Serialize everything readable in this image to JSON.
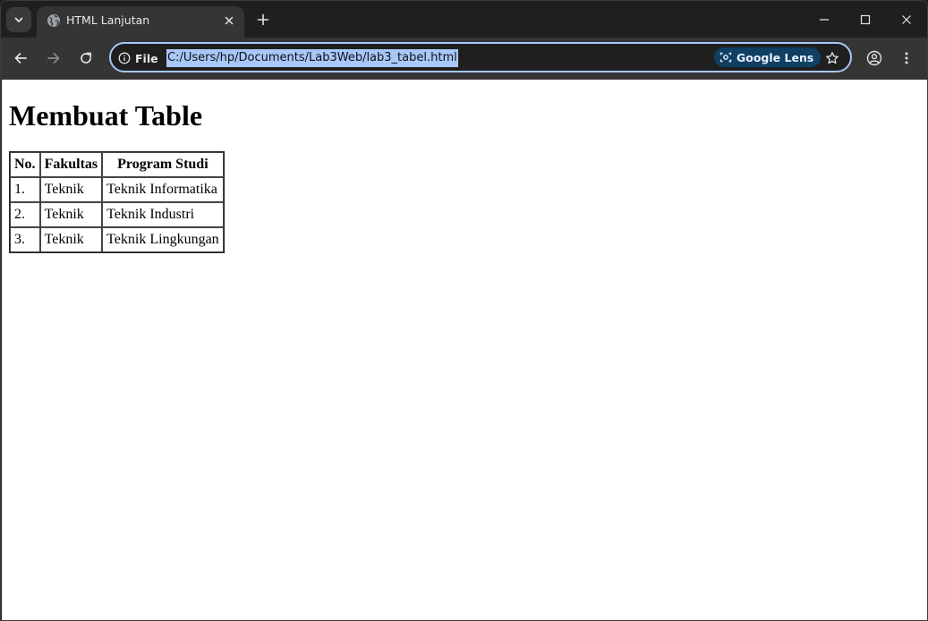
{
  "browser": {
    "tab": {
      "title": "HTML Lanjutan",
      "favicon": "globe-icon"
    },
    "toolbar": {
      "site_info_label": "File",
      "url": "C:/Users/hp/Documents/Lab3Web/lab3_tabel.html",
      "lens_label": "Google Lens"
    },
    "colors": {
      "frame": "#1f1f1f",
      "toolbar": "#353535",
      "omnibox_border": "#a8c7fa",
      "selection": "#a8c7fa",
      "lens_chip": "#0f3f63"
    }
  },
  "page": {
    "heading": "Membuat Table",
    "table": {
      "headers": [
        "No.",
        "Fakultas",
        "Program Studi"
      ],
      "rows": [
        [
          "1.",
          "Teknik",
          "Teknik Informatika"
        ],
        [
          "2.",
          "Teknik",
          "Teknik Industri"
        ],
        [
          "3.",
          "Teknik",
          "Teknik Lingkungan"
        ]
      ]
    }
  }
}
